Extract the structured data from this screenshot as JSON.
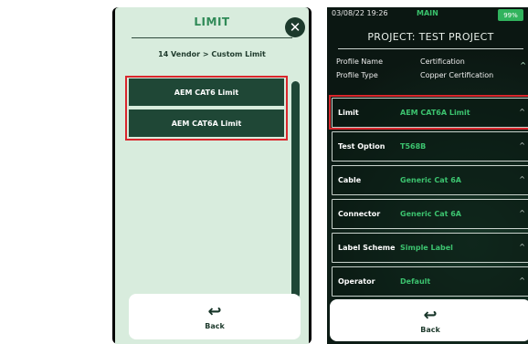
{
  "left": {
    "title": "LIMIT",
    "breadcrumb": "14 Vendor > Custom Limit",
    "items": [
      {
        "label": "AEM CAT6 Limit"
      },
      {
        "label": "AEM CAT6A Limit"
      }
    ],
    "back_label": "Back"
  },
  "right": {
    "status": {
      "datetime": "03/08/22 19:26",
      "mode": "MAIN",
      "battery": "99%"
    },
    "project_title": "PROJECT: TEST PROJECT",
    "info": [
      {
        "label": "Profile Name",
        "value": "Certification"
      },
      {
        "label": "Profile Type",
        "value": "Copper Certification"
      }
    ],
    "rows": [
      {
        "label": "Limit",
        "value": "AEM CAT6A Limit"
      },
      {
        "label": "Test Option",
        "value": "T568B"
      },
      {
        "label": "Cable",
        "value": "Generic Cat 6A"
      },
      {
        "label": "Connector",
        "value": "Generic Cat 6A"
      },
      {
        "label": "Label Scheme",
        "value": "Simple Label"
      },
      {
        "label": "Operator",
        "value": "Default"
      }
    ],
    "back_label": "Back"
  },
  "colors": {
    "accent_green": "#3cc36f",
    "highlight": "#d9262c",
    "dark_green": "#1f4736"
  }
}
